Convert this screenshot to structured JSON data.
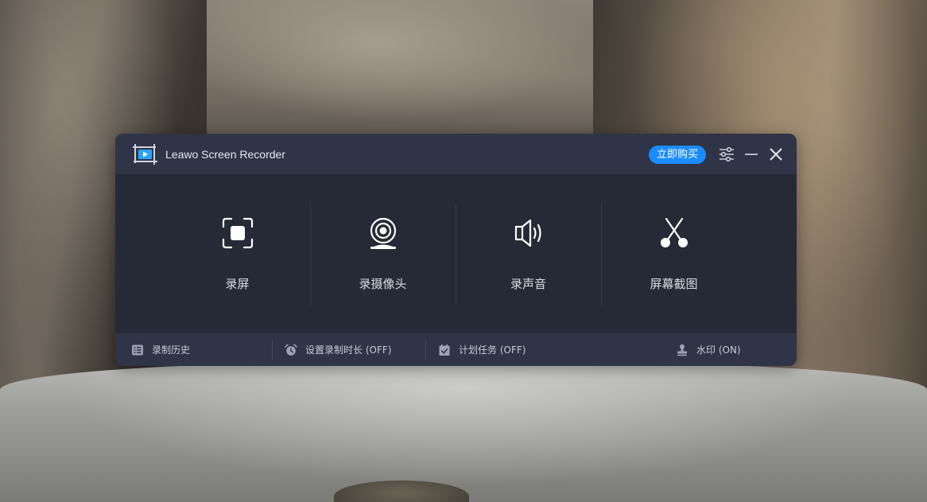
{
  "window": {
    "title": "Leawo Screen Recorder",
    "buy_label": "立即购买",
    "accent_color": "#1a8cff"
  },
  "features": [
    {
      "label": "录屏",
      "icon": "record-screen-icon"
    },
    {
      "label": "录摄像头",
      "icon": "webcam-icon"
    },
    {
      "label": "录声音",
      "icon": "speaker-icon"
    },
    {
      "label": "屏幕截图",
      "icon": "scissors-icon"
    }
  ],
  "bottom_bar": {
    "history": "录制历史",
    "duration": "设置录制时长 (OFF)",
    "schedule": "计划任务 (OFF)",
    "watermark": "水印 (ON)"
  }
}
